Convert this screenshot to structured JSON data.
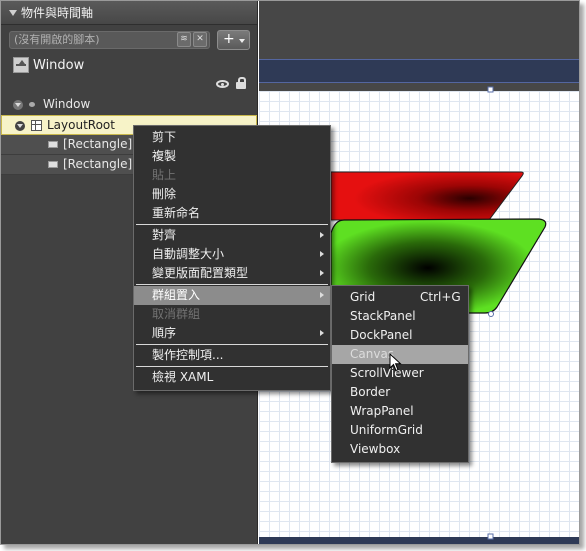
{
  "panel": {
    "title": "物件與時間軸",
    "scope_placeholder": "(沒有開啟的腳本)",
    "add_label": "+"
  },
  "scope": {
    "name": "Window"
  },
  "tree": {
    "items": [
      {
        "label": "Window"
      },
      {
        "label": "LayoutRoot"
      },
      {
        "label": "[Rectangle]"
      },
      {
        "label": "[Rectangle]"
      }
    ]
  },
  "context_menu": {
    "items": [
      {
        "label": "剪下"
      },
      {
        "label": "複製"
      },
      {
        "label": "貼上"
      },
      {
        "label": "刪除"
      },
      {
        "label": "重新命名"
      },
      {
        "label": "對齊"
      },
      {
        "label": "自動調整大小"
      },
      {
        "label": "變更版面配置類型"
      },
      {
        "label": "群組置入"
      },
      {
        "label": "取消群組"
      },
      {
        "label": "順序"
      },
      {
        "label": "製作控制項..."
      },
      {
        "label": "檢視 XAML"
      }
    ]
  },
  "group_into_menu": {
    "items": [
      {
        "label": "Grid",
        "shortcut": "Ctrl+G"
      },
      {
        "label": "StackPanel"
      },
      {
        "label": "DockPanel"
      },
      {
        "label": "Canvas"
      },
      {
        "label": "ScrollViewer"
      },
      {
        "label": "Border"
      },
      {
        "label": "WrapPanel"
      },
      {
        "label": "UniformGrid"
      },
      {
        "label": "Viewbox"
      }
    ]
  },
  "colors": {
    "panel_bg": "#414141",
    "menu_bg": "#313131",
    "selection": "#f7f3c8",
    "shape_red": "#e01010",
    "shape_green": "#5ee022"
  }
}
